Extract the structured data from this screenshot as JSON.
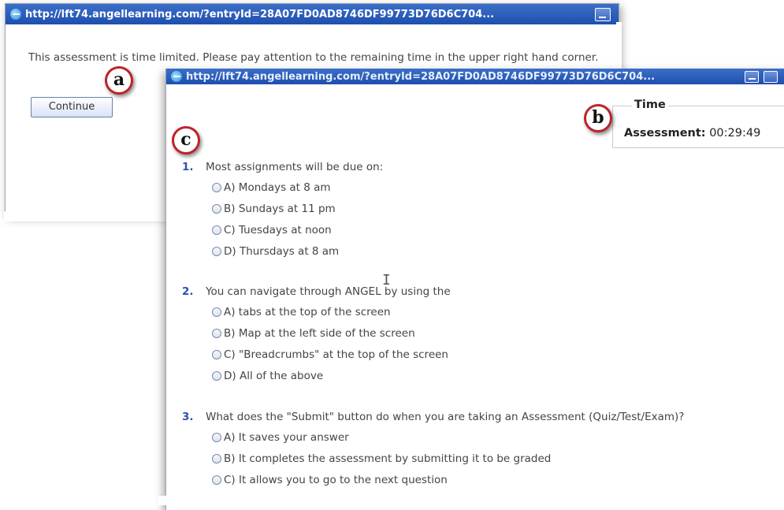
{
  "window_a": {
    "title": "http://lft74.angellearning.com/?entryId=28A07FD0AD8746DF99773D76D6C704...",
    "message": "This assessment is time limited. Please pay attention to the remaining time in the upper right hand corner.",
    "continue_label": "Continue"
  },
  "window_b": {
    "title": "http://lft74.angellearning.com/?entryId=28A07FD0AD8746DF99773D76D6C704...",
    "time": {
      "legend": "Time",
      "label": "Assessment:",
      "value": "00:29:49"
    },
    "questions": [
      {
        "num": "1.",
        "text": "Most assignments will be due on:",
        "options": [
          "A) Mondays at 8 am",
          "B) Sundays at 11 pm",
          "C) Tuesdays at noon",
          "D) Thursdays at 8 am"
        ]
      },
      {
        "num": "2.",
        "text": "You can navigate through ANGEL by using the",
        "options": [
          "A) tabs at the top of the screen",
          "B) Map at the left side of the screen",
          "C) \"Breadcrumbs\" at the top of the screen",
          "D) All of the above"
        ]
      },
      {
        "num": "3.",
        "text": "What does the \"Submit\" button do when you are taking an Assessment (Quiz/Test/Exam)?",
        "options": [
          "A) It saves your answer",
          "B) It completes the assessment by submitting it to be graded",
          "C) It allows you to go to the next question"
        ]
      }
    ]
  },
  "callouts": {
    "a": "a",
    "b": "b",
    "c": "c"
  }
}
